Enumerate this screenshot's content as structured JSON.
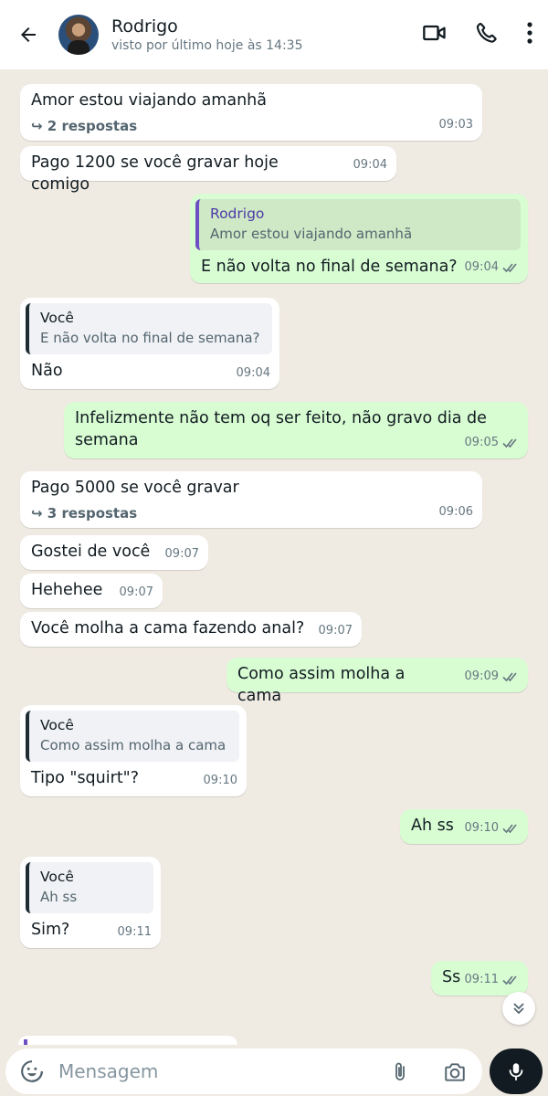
{
  "header": {
    "contact_name": "Rodrigo",
    "status": "visto por último hoje às 14:35",
    "icons": [
      "back-arrow-icon",
      "video-call-icon",
      "voice-call-icon",
      "more-options-icon"
    ]
  },
  "messages": [
    {
      "dir": "in",
      "text": "Amor estou viajando amanhã",
      "replies": "2 respostas",
      "time": "09:03"
    },
    {
      "dir": "in",
      "text": "Pago 1200 se você gravar hoje comigo",
      "time": "09:04"
    },
    {
      "dir": "out",
      "quote_author": "Rodrigo",
      "quote_text": "Amor estou viajando amanhã",
      "text": "E não volta no final de semana?",
      "time": "09:04"
    },
    {
      "dir": "in",
      "quote_author": "Você",
      "quote_text": "E não volta no final de semana?",
      "text": "Não",
      "time": "09:04"
    },
    {
      "dir": "out",
      "text_line1": "Infelizmente não tem oq ser feito, não gravo dia de",
      "text_line2": "semana",
      "time": "09:05"
    },
    {
      "dir": "in",
      "text": "Pago 5000 se você gravar",
      "replies": "3 respostas",
      "time": "09:06"
    },
    {
      "dir": "in",
      "text": "Gostei de você",
      "time": "09:07"
    },
    {
      "dir": "in",
      "text": "Hehehee",
      "time": "09:07"
    },
    {
      "dir": "in",
      "text": "Você molha a cama fazendo anal?",
      "time": "09:07"
    },
    {
      "dir": "out",
      "text": "Como assim molha a cama",
      "time": "09:09"
    },
    {
      "dir": "in",
      "quote_author": "Você",
      "quote_text": "Como assim molha a cama",
      "text": "Tipo \"squirt\"?",
      "time": "09:10"
    },
    {
      "dir": "out",
      "text": "Ah ss",
      "time": "09:10"
    },
    {
      "dir": "in",
      "quote_author": "Você",
      "quote_text": "Ah ss",
      "text": "Sim?",
      "time": "09:11"
    },
    {
      "dir": "out",
      "text": "Ss",
      "time": "09:11"
    }
  ],
  "input": {
    "placeholder": "Mensagem",
    "icons": [
      "emoji-icon",
      "attach-icon",
      "camera-icon",
      "mic-icon"
    ]
  },
  "colors": {
    "incoming": "#ffffff",
    "outgoing": "#d9fdd3",
    "background": "#efeae2",
    "read_ticks": "#667781"
  }
}
